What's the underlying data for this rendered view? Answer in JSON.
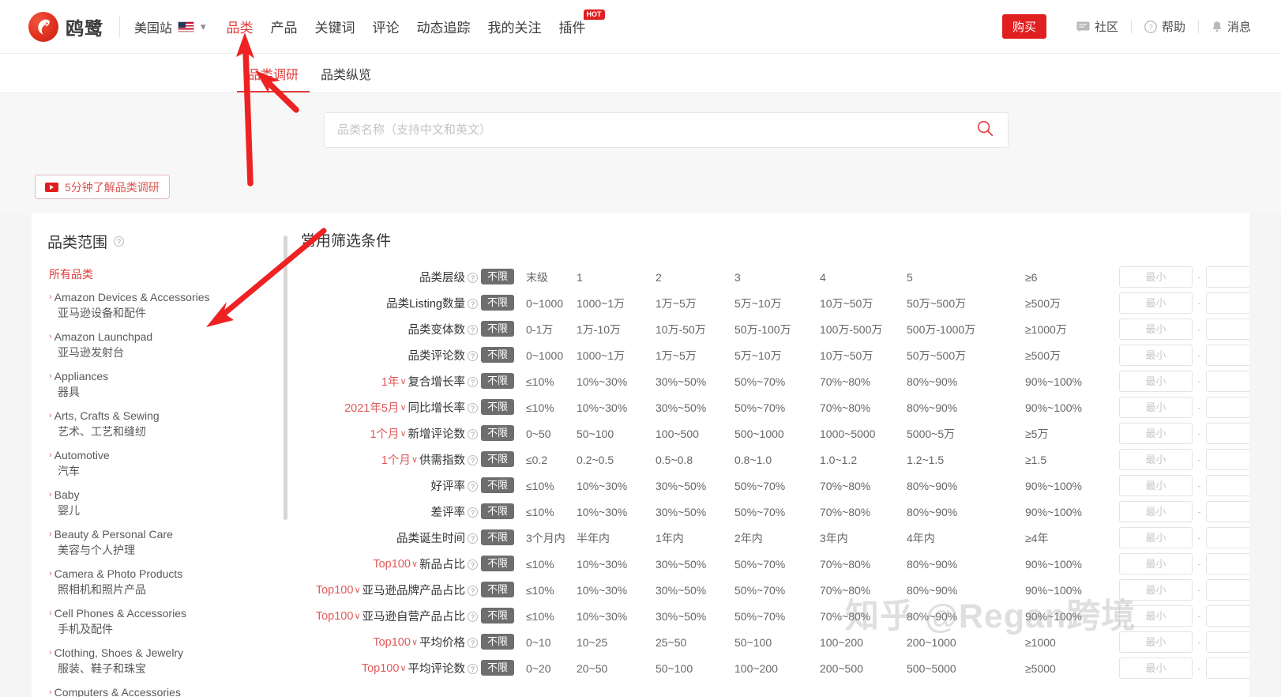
{
  "header": {
    "logo_text": "鸥鹭",
    "site_label": "美国站",
    "nav": [
      {
        "label": "品类",
        "active": true,
        "hot": false
      },
      {
        "label": "产品",
        "active": false,
        "hot": false
      },
      {
        "label": "关键词",
        "active": false,
        "hot": false
      },
      {
        "label": "评论",
        "active": false,
        "hot": false
      },
      {
        "label": "动态追踪",
        "active": false,
        "hot": false
      },
      {
        "label": "我的关注",
        "active": false,
        "hot": false
      },
      {
        "label": "插件",
        "active": false,
        "hot": true,
        "hot_label": "HOT"
      }
    ],
    "buy_label": "购买",
    "community_label": "社区",
    "help_label": "帮助",
    "message_label": "消息"
  },
  "subnav": [
    {
      "label": "品类调研",
      "active": true
    },
    {
      "label": "品类纵览",
      "active": false
    }
  ],
  "search": {
    "placeholder": "品类名称（支持中文和英文）",
    "value": ""
  },
  "video_button": {
    "label": "5分钟了解品类调研"
  },
  "sidebar": {
    "title": "品类范围",
    "all_label": "所有品类",
    "items": [
      {
        "en": "Amazon Devices & Accessories",
        "cn": "亚马逊设备和配件"
      },
      {
        "en": "Amazon Launchpad",
        "cn": "亚马逊发射台"
      },
      {
        "en": "Appliances",
        "cn": "器具"
      },
      {
        "en": "Arts, Crafts & Sewing",
        "cn": "艺术、工艺和缝纫"
      },
      {
        "en": "Automotive",
        "cn": "汽车"
      },
      {
        "en": "Baby",
        "cn": "婴儿"
      },
      {
        "en": "Beauty & Personal Care",
        "cn": "美容与个人护理"
      },
      {
        "en": "Camera & Photo Products",
        "cn": "照相机和照片产品"
      },
      {
        "en": "Cell Phones & Accessories",
        "cn": "手机及配件"
      },
      {
        "en": "Clothing, Shoes & Jewelry",
        "cn": "服装、鞋子和珠宝"
      },
      {
        "en": "Computers & Accessories",
        "cn": ""
      }
    ]
  },
  "filters": {
    "section_title": "常用筛选条件",
    "unlimited_label": "不限",
    "min_placeholder": "最小",
    "max_placeholder": "",
    "rows": [
      {
        "prefix": "",
        "label": "品类层级",
        "options": [
          "末级",
          "1",
          "2",
          "3",
          "4",
          "5",
          "≥6"
        ]
      },
      {
        "prefix": "",
        "label": "品类Listing数量",
        "options": [
          "0~1000",
          "1000~1万",
          "1万~5万",
          "5万~10万",
          "10万~50万",
          "50万~500万",
          "≥500万"
        ]
      },
      {
        "prefix": "",
        "label": "品类变体数",
        "options": [
          "0-1万",
          "1万-10万",
          "10万-50万",
          "50万-100万",
          "100万-500万",
          "500万-1000万",
          "≥1000万"
        ]
      },
      {
        "prefix": "",
        "label": "品类评论数",
        "options": [
          "0~1000",
          "1000~1万",
          "1万~5万",
          "5万~10万",
          "10万~50万",
          "50万~500万",
          "≥500万"
        ]
      },
      {
        "prefix": "1年",
        "label": "复合增长率",
        "options": [
          "≤10%",
          "10%~30%",
          "30%~50%",
          "50%~70%",
          "70%~80%",
          "80%~90%",
          "90%~100%"
        ]
      },
      {
        "prefix": "2021年5月",
        "label": "同比增长率",
        "options": [
          "≤10%",
          "10%~30%",
          "30%~50%",
          "50%~70%",
          "70%~80%",
          "80%~90%",
          "90%~100%"
        ]
      },
      {
        "prefix": "1个月",
        "label": "新增评论数",
        "options": [
          "0~50",
          "50~100",
          "100~500",
          "500~1000",
          "1000~5000",
          "5000~5万",
          "≥5万"
        ]
      },
      {
        "prefix": "1个月",
        "label": "供需指数",
        "options": [
          "≤0.2",
          "0.2~0.5",
          "0.5~0.8",
          "0.8~1.0",
          "1.0~1.2",
          "1.2~1.5",
          "≥1.5"
        ]
      },
      {
        "prefix": "",
        "label": "好评率",
        "options": [
          "≤10%",
          "10%~30%",
          "30%~50%",
          "50%~70%",
          "70%~80%",
          "80%~90%",
          "90%~100%"
        ]
      },
      {
        "prefix": "",
        "label": "差评率",
        "options": [
          "≤10%",
          "10%~30%",
          "30%~50%",
          "50%~70%",
          "70%~80%",
          "80%~90%",
          "90%~100%"
        ]
      },
      {
        "prefix": "",
        "label": "品类诞生时间",
        "options": [
          "3个月内",
          "半年内",
          "1年内",
          "2年内",
          "3年内",
          "4年内",
          "≥4年"
        ]
      },
      {
        "prefix": "Top100",
        "label": "新品占比",
        "options": [
          "≤10%",
          "10%~30%",
          "30%~50%",
          "50%~70%",
          "70%~80%",
          "80%~90%",
          "90%~100%"
        ]
      },
      {
        "prefix": "Top100",
        "label": "亚马逊品牌产品占比",
        "options": [
          "≤10%",
          "10%~30%",
          "30%~50%",
          "50%~70%",
          "70%~80%",
          "80%~90%",
          "90%~100%"
        ]
      },
      {
        "prefix": "Top100",
        "label": "亚马逊自营产品占比",
        "options": [
          "≤10%",
          "10%~30%",
          "30%~50%",
          "50%~70%",
          "70%~80%",
          "80%~90%",
          "90%~100%"
        ]
      },
      {
        "prefix": "Top100",
        "label": "平均价格",
        "options": [
          "0~10",
          "10~25",
          "25~50",
          "50~100",
          "100~200",
          "200~1000",
          "≥1000"
        ]
      },
      {
        "prefix": "Top100",
        "label": "平均评论数",
        "options": [
          "0~20",
          "20~50",
          "50~100",
          "100~200",
          "200~500",
          "500~5000",
          "≥5000"
        ]
      }
    ]
  },
  "watermark": "知乎 @Regan跨境",
  "colors": {
    "brand_red": "#e02020",
    "accent_red": "#e23c3c",
    "badge_gray": "#6e6e6e",
    "page_bg": "#f5f5f5"
  }
}
